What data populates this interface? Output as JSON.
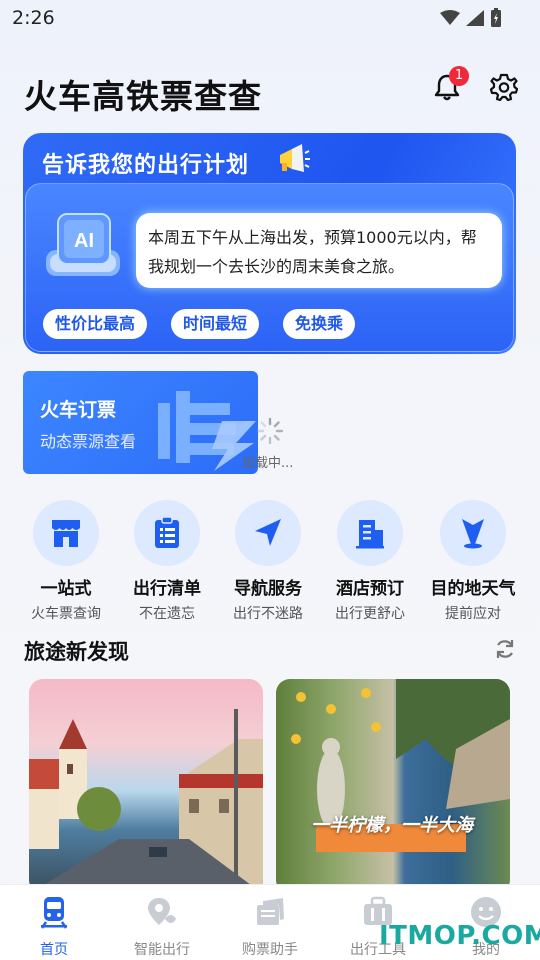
{
  "status_bar": {
    "time": "2:26"
  },
  "header": {
    "title": "火车高铁票查查",
    "notification_count": "1"
  },
  "plan": {
    "title": "告诉我您的出行计划",
    "ai_label": "AI",
    "prompt_text": "本周五下午从上海出发，预算1000元以内，帮我规划一个去长沙的周末美食之旅。",
    "chips": [
      "性价比最高",
      "时间最短",
      "免换乘"
    ]
  },
  "train_card": {
    "title": "火车订票",
    "subtitle": "动态票源查看"
  },
  "loading": {
    "text": "加载中..."
  },
  "services": [
    {
      "title": "一站式",
      "subtitle": "火车票查询",
      "icon": "shop-icon"
    },
    {
      "title": "出行清单",
      "subtitle": "不在遗忘",
      "icon": "checklist-icon"
    },
    {
      "title": "导航服务",
      "subtitle": "出行不迷路",
      "icon": "navigation-icon"
    },
    {
      "title": "酒店预订",
      "subtitle": "出行更舒心",
      "icon": "hotel-icon"
    },
    {
      "title": "目的地天气",
      "subtitle": "提前应对",
      "icon": "location-icon"
    }
  ],
  "discover": {
    "title": "旅途新发现",
    "cards": [
      {
        "caption": ""
      },
      {
        "caption": "一半柠檬，一半大海"
      }
    ]
  },
  "tabs": [
    {
      "label": "首页",
      "icon": "train-icon",
      "active": true
    },
    {
      "label": "智能出行",
      "icon": "map-pin-icon",
      "active": false
    },
    {
      "label": "购票助手",
      "icon": "tickets-icon",
      "active": false
    },
    {
      "label": "出行工具",
      "icon": "briefcase-icon",
      "active": false
    },
    {
      "label": "我的",
      "icon": "profile-icon",
      "active": false
    }
  ],
  "watermark": "ITMOP.COM",
  "colors": {
    "accent": "#2563eb",
    "badge": "#f0283a",
    "service_bg": "#dde9ff",
    "watermark": "#19a9a0"
  }
}
